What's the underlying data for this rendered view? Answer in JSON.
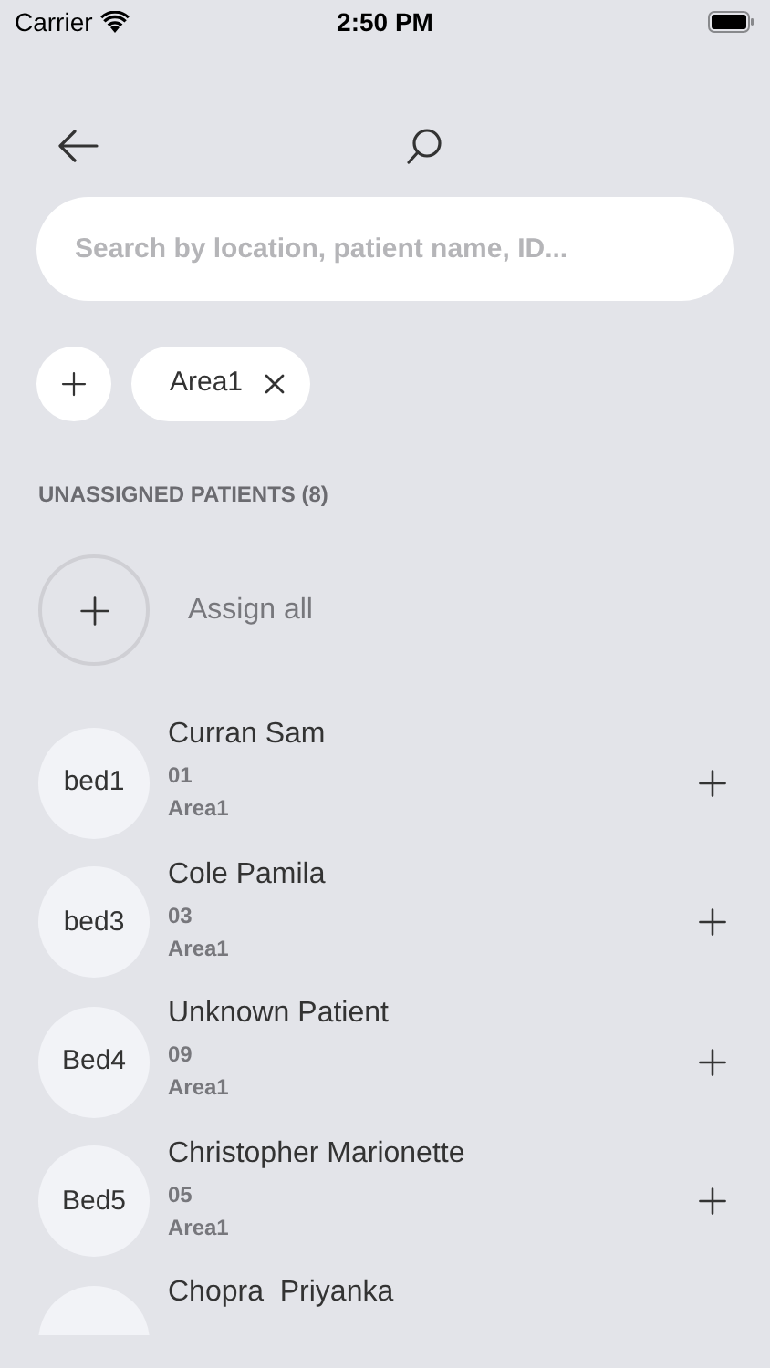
{
  "status_bar": {
    "carrier": "Carrier",
    "time": "2:50 PM"
  },
  "search": {
    "placeholder": "Search by location, patient name, ID..."
  },
  "filters": [
    {
      "label": "Area1"
    }
  ],
  "section": {
    "title": "UNASSIGNED PATIENTS (8)"
  },
  "assign_all": {
    "label": "Assign all"
  },
  "patients": [
    {
      "bed": "bed1",
      "name": "Curran Sam",
      "id": "01",
      "area": "Area1"
    },
    {
      "bed": "bed3",
      "name": "Cole Pamila",
      "id": "03",
      "area": "Area1"
    },
    {
      "bed": "Bed4",
      "name": "Unknown Patient",
      "id": "09",
      "area": "Area1"
    },
    {
      "bed": "Bed5",
      "name": "Christopher Marionette",
      "id": "05",
      "area": "Area1"
    },
    {
      "name": "Chopra  Priyanka"
    }
  ]
}
